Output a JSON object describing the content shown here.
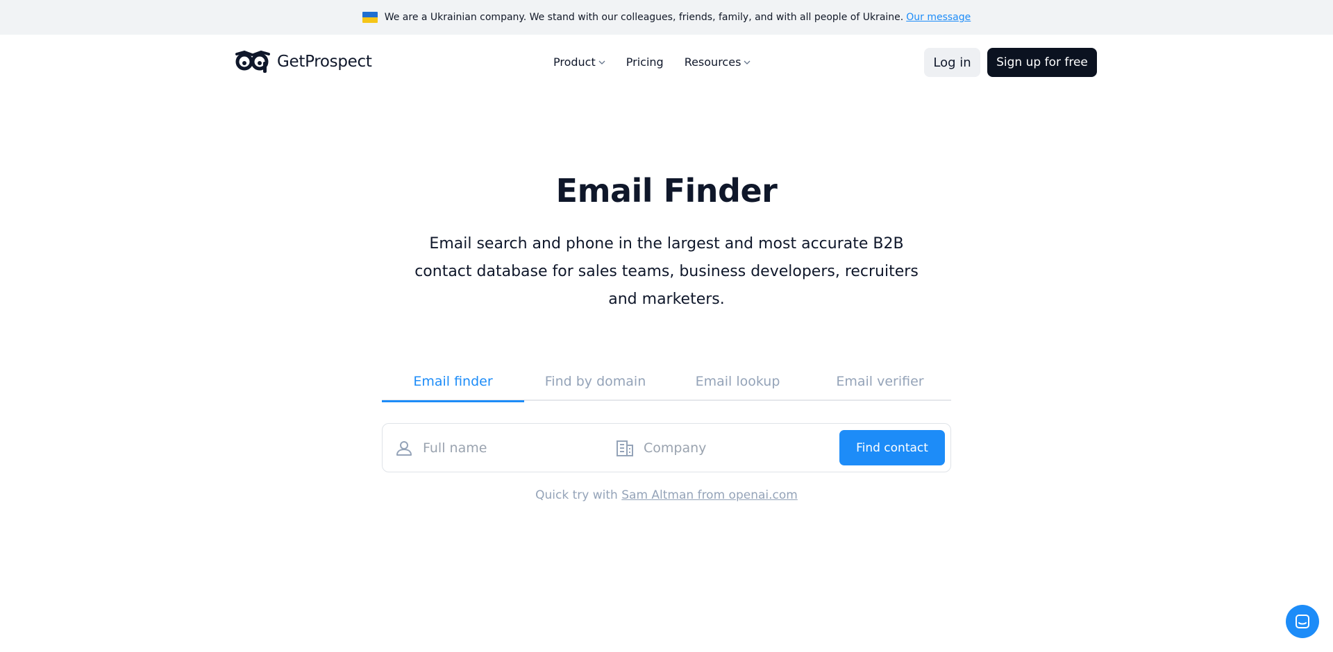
{
  "banner": {
    "message": "We are a Ukrainian company. We stand with our colleagues, friends, family, and with all people of Ukraine.",
    "link": "Our message",
    "flag_colors": [
      "#1f6fd1",
      "#f5c518"
    ]
  },
  "header": {
    "logo_text": "GetProspect",
    "menu": [
      {
        "label": "Product",
        "has_dropdown": true
      },
      {
        "label": "Pricing",
        "has_dropdown": false
      },
      {
        "label": "Resources",
        "has_dropdown": true
      }
    ],
    "login_label": "Log in",
    "signup_label": "Sign up for free"
  },
  "hero": {
    "title": "Email Finder",
    "subtitle": "Email search and phone in the largest and most accurate B2B contact database for sales teams, business developers, recruiters and marketers."
  },
  "tabs": [
    {
      "label": "Email finder",
      "active": true
    },
    {
      "label": "Find by domain",
      "active": false
    },
    {
      "label": "Email lookup",
      "active": false
    },
    {
      "label": "Email verifier",
      "active": false
    }
  ],
  "search": {
    "fullname_placeholder": "Full name",
    "fullname_value": "",
    "company_placeholder": "Company",
    "company_value": "",
    "find_label": "Find contact"
  },
  "quick_try": {
    "prefix": "Quick try with",
    "link": "Sam Altman from openai.com"
  },
  "icons": {
    "person": "person-icon",
    "company": "building-icon",
    "chat": "chat-icon"
  },
  "colors": {
    "accent": "#1d8cf8",
    "dark": "#0b1220",
    "banner_bg": "#f1f3f5"
  }
}
